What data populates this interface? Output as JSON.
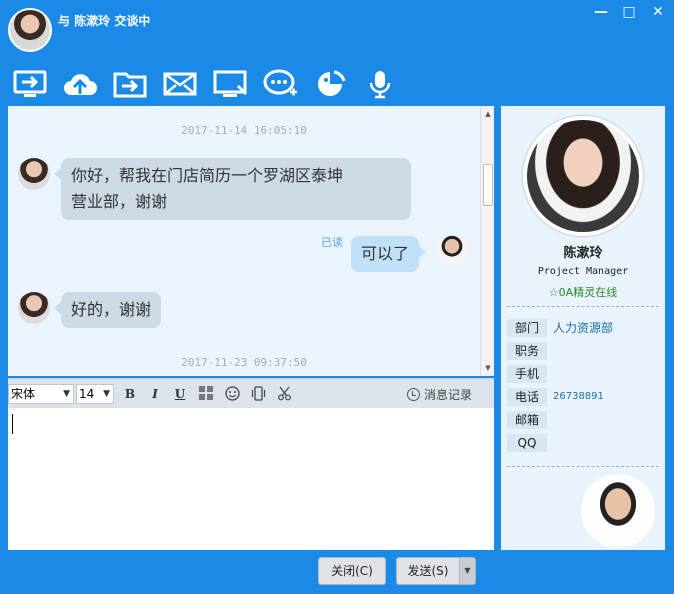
{
  "titlebar": {
    "prefix": "与",
    "name": "陈漱玲",
    "suffix": "交谈中",
    "min_label": "—",
    "max_label": "□",
    "close_label": "✕"
  },
  "toolbar": {
    "items": [
      {
        "icon": "screen-share-icon"
      },
      {
        "icon": "cloud-upload-icon"
      },
      {
        "icon": "folder-send-icon"
      },
      {
        "icon": "mail-icon"
      },
      {
        "icon": "remote-desktop-icon"
      },
      {
        "icon": "group-chat-icon"
      },
      {
        "icon": "screenshot-icon"
      },
      {
        "icon": "microphone-icon"
      }
    ]
  },
  "chat": {
    "messages": [
      {
        "type": "time",
        "text": "2017-11-14 16:05:10"
      },
      {
        "type": "in",
        "lines": [
          "你好，帮我在门店简历一个罗湖区泰坤",
          "营业部，谢谢"
        ]
      },
      {
        "type": "out",
        "text": "可以了",
        "status": "已读"
      },
      {
        "type": "in",
        "text": "好的，谢谢"
      },
      {
        "type": "time",
        "text": "2017-11-23 09:37:50"
      }
    ]
  },
  "format": {
    "font": "宋体",
    "size": "14",
    "bold": "B",
    "italic": "I",
    "underline": "U",
    "history_label": "消息记录"
  },
  "buttons": {
    "close": "关闭(C)",
    "send": "发送(S)"
  },
  "profile": {
    "name": "陈漱玲",
    "title": "Project Manager",
    "status": "0A精灵在线",
    "fields": [
      {
        "label": "部门",
        "value": "人力资源部"
      },
      {
        "label": "职务",
        "value": ""
      },
      {
        "label": "手机",
        "value": ""
      },
      {
        "label": "电话",
        "value": "26738891"
      },
      {
        "label": "邮箱",
        "value": ""
      },
      {
        "label": "QQ",
        "value": ""
      }
    ]
  },
  "colors": {
    "frame": "#1a8ae6",
    "chat_bg": "#eaf4fc",
    "bubble_in": "#cdd9e4",
    "bubble_out": "#bfe0f7"
  }
}
